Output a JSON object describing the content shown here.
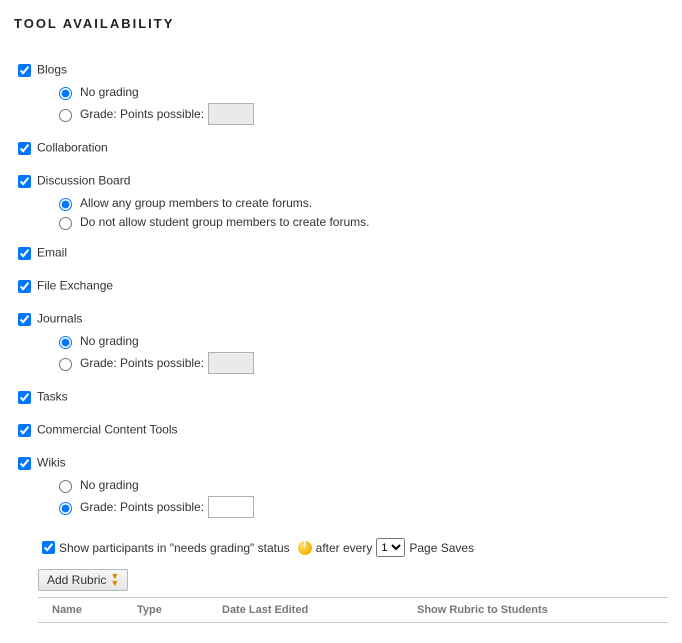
{
  "section_title": "TOOL AVAILABILITY",
  "tools": [
    {
      "key": "blogs",
      "label": "Blogs",
      "checked": true,
      "grading": {
        "selected": "no_grading",
        "no_grading_label": "No grading",
        "points_label": "Grade: Points possible:",
        "points_value": "",
        "points_enabled": false
      }
    },
    {
      "key": "collaboration",
      "label": "Collaboration",
      "checked": true
    },
    {
      "key": "discussion_board",
      "label": "Discussion Board",
      "checked": true,
      "forum_options": {
        "selected": "allow",
        "allow_label": "Allow any group members to create forums.",
        "disallow_label": "Do not allow student group members to create forums."
      }
    },
    {
      "key": "email",
      "label": "Email",
      "checked": true
    },
    {
      "key": "file_exchange",
      "label": "File Exchange",
      "checked": true
    },
    {
      "key": "journals",
      "label": "Journals",
      "checked": true,
      "grading": {
        "selected": "no_grading",
        "no_grading_label": "No grading",
        "points_label": "Grade: Points possible:",
        "points_value": "",
        "points_enabled": false
      }
    },
    {
      "key": "tasks",
      "label": "Tasks",
      "checked": true
    },
    {
      "key": "commercial_content_tools",
      "label": "Commercial Content Tools",
      "checked": true
    },
    {
      "key": "wikis",
      "label": "Wikis",
      "checked": true,
      "grading": {
        "selected": "points",
        "no_grading_label": "No grading",
        "points_label": "Grade: Points possible:",
        "points_value": "",
        "points_enabled": true
      }
    }
  ],
  "needs_grading": {
    "checked": true,
    "text_before": "Show participants in \"needs grading\" status",
    "text_after": "after every",
    "text_tail": "Page Saves",
    "selected": "1",
    "options": [
      "1"
    ]
  },
  "add_rubric_label": "Add Rubric",
  "rubric_table": {
    "col_name": "Name",
    "col_type": "Type",
    "col_date": "Date Last Edited",
    "col_show": "Show Rubric to Students"
  }
}
